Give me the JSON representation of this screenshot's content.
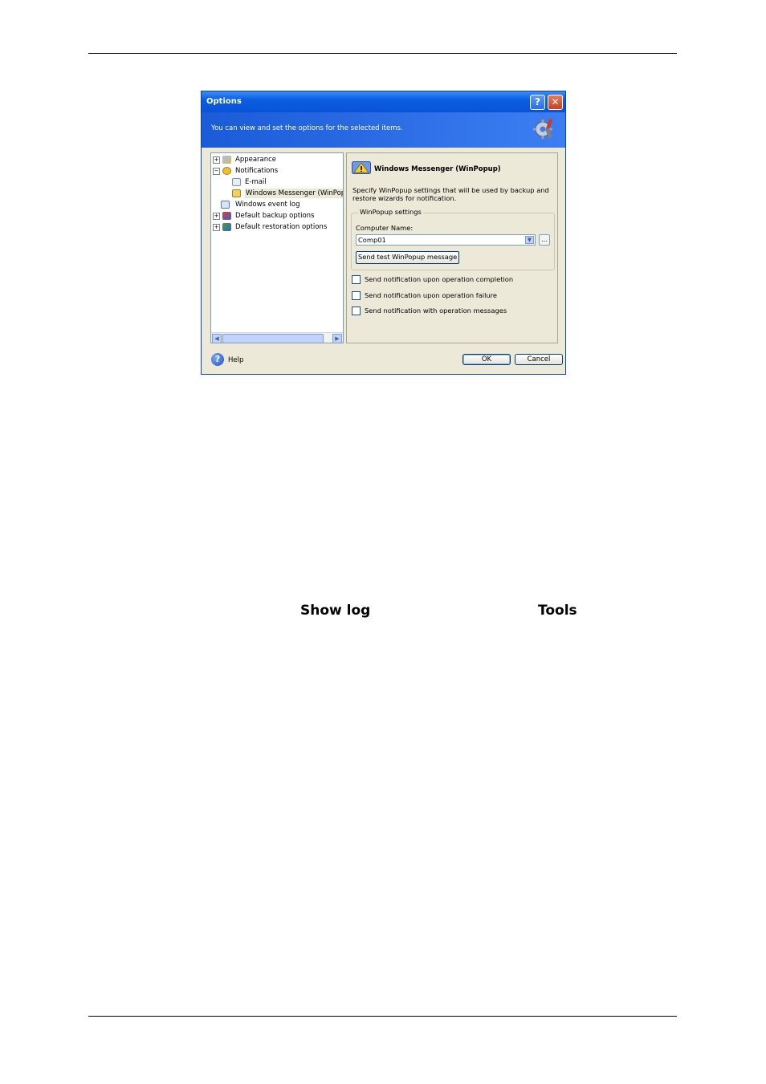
{
  "dialog": {
    "title": "Options",
    "help_title_button": "?",
    "close_title_button": "✕",
    "banner_text": "You can view and set the options for the selected items.",
    "banner_icon": "gear-icon",
    "tree": [
      {
        "label": "Appearance",
        "expander": "+",
        "icon": "appearance-icon"
      },
      {
        "label": "Notifications",
        "expander": "−",
        "icon": "notifications-icon"
      },
      {
        "label": "E-mail",
        "icon": "email-icon"
      },
      {
        "label": "Windows Messenger (WinPopup)",
        "icon": "messenger-icon",
        "selected": true
      },
      {
        "label": "Windows event log",
        "icon": "event-log-icon"
      },
      {
        "label": "Default backup options",
        "expander": "+",
        "icon": "backup-icon"
      },
      {
        "label": "Default restoration options",
        "expander": "+",
        "icon": "restore-icon"
      }
    ],
    "pane": {
      "title": "Windows Messenger (WinPopup)",
      "description": "Specify WinPopup settings that will be used by backup and restore wizards for notification.",
      "group_label": "WinPopup settings",
      "computer_name_label": "Computer Name:",
      "computer_name_value": "Comp01",
      "browse_label": "...",
      "test_button": "Send test WinPopup message",
      "checkboxes": [
        {
          "label": "Send notification upon operation completion",
          "checked": false
        },
        {
          "label": "Send notification upon operation failure",
          "checked": false
        },
        {
          "label": "Send notification with operation messages",
          "checked": false
        }
      ]
    },
    "help_label": "Help",
    "ok_label": "OK",
    "cancel_label": "Cancel"
  },
  "body_terms": {
    "show_log": "Show log",
    "tools": "Tools"
  }
}
